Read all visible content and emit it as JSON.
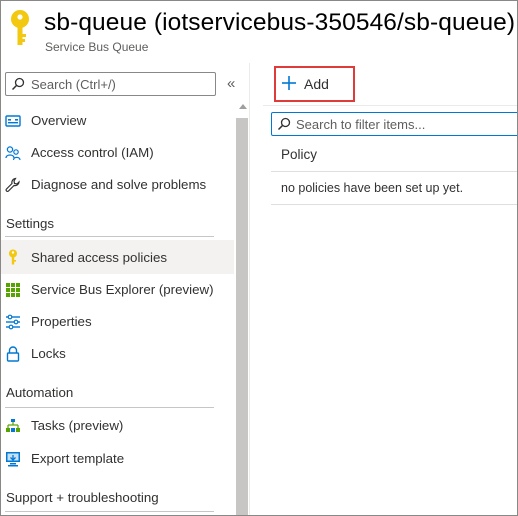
{
  "header": {
    "title": "sb-queue (iotservicebus-350546/sb-queue)",
    "subtitle": "Service Bus Queue"
  },
  "sidebar": {
    "search_placeholder": "Search (Ctrl+/)",
    "collapse_glyph": "«",
    "items": [
      {
        "label": "Overview",
        "icon": "overview-icon"
      },
      {
        "label": "Access control (IAM)",
        "icon": "people-icon"
      },
      {
        "label": "Diagnose and solve problems",
        "icon": "wrench-icon"
      }
    ],
    "sections": [
      {
        "title": "Settings"
      },
      {
        "title": "Automation"
      },
      {
        "title": "Support + troubleshooting"
      }
    ],
    "settings_items": [
      {
        "label": "Shared access policies",
        "icon": "key-icon",
        "selected": true
      },
      {
        "label": "Service Bus Explorer (preview)",
        "icon": "grid-icon"
      },
      {
        "label": "Properties",
        "icon": "sliders-icon"
      },
      {
        "label": "Locks",
        "icon": "lock-icon"
      }
    ],
    "automation_items": [
      {
        "label": "Tasks (preview)",
        "icon": "tasks-icon"
      },
      {
        "label": "Export template",
        "icon": "export-icon"
      }
    ]
  },
  "toolbar": {
    "add_label": "Add",
    "highlight_color": "#e03b3b"
  },
  "content": {
    "filter_placeholder": "Search to filter items...",
    "column_header": "Policy",
    "empty_message": "no policies have been set up yet."
  },
  "colors": {
    "accent": "#0078d4",
    "key_yellow": "#f2c811",
    "selected_bg": "#f3f2f1"
  }
}
